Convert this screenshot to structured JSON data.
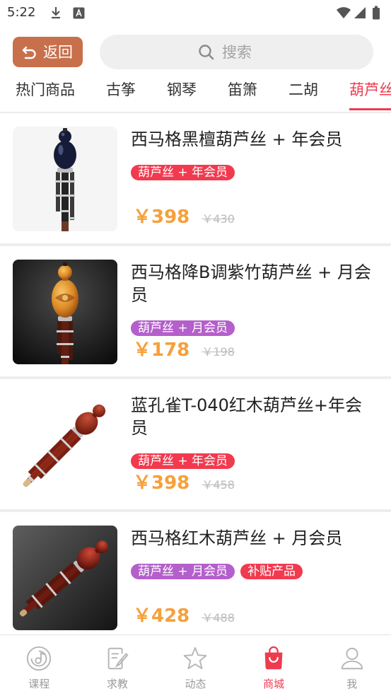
{
  "status_bar": {
    "time": "5:22",
    "left_icons": [
      "download-icon",
      "a-icon"
    ],
    "right_icons": [
      "wifi-icon",
      "signal-icon",
      "battery-icon"
    ]
  },
  "header": {
    "back_label": "返回",
    "back_icon": "return-arrow-icon",
    "search_placeholder": "搜索",
    "search_icon": "search-icon"
  },
  "tabs": [
    {
      "label": "热门商品",
      "active": false
    },
    {
      "label": "古筝",
      "active": false
    },
    {
      "label": "钢琴",
      "active": false
    },
    {
      "label": "笛箫",
      "active": false
    },
    {
      "label": "二胡",
      "active": false
    },
    {
      "label": "葫芦丝",
      "active": true
    }
  ],
  "products": [
    {
      "title": "西马格黑檀葫芦丝 + 年会员",
      "tags": [
        {
          "text": "葫芦丝 + 年会员",
          "color": "#f23a4f"
        }
      ],
      "price": "￥398",
      "original_price": "￥430"
    },
    {
      "title": "西马格降B调紫竹葫芦丝 + 月会员",
      "tags": [
        {
          "text": "葫芦丝 + 月会员",
          "color": "#b45fcb"
        }
      ],
      "price": "￥178",
      "original_price": "￥198"
    },
    {
      "title": "蓝孔雀T-040红木葫芦丝+年会员",
      "tags": [
        {
          "text": "葫芦丝 + 年会员",
          "color": "#f23a4f"
        }
      ],
      "price": "￥398",
      "original_price": "￥458"
    },
    {
      "title": "西马格红木葫芦丝 + 月会员",
      "tags": [
        {
          "text": "葫芦丝 + 月会员",
          "color": "#b45fcb"
        },
        {
          "text": "补贴产品",
          "color": "#f23a4f"
        }
      ],
      "price": "￥428",
      "original_price": "￥488"
    }
  ],
  "bottom_nav": [
    {
      "label": "课程",
      "icon": "course-disc-icon",
      "active": false
    },
    {
      "label": "求教",
      "icon": "edit-document-icon",
      "active": false
    },
    {
      "label": "动态",
      "icon": "star-icon",
      "active": false
    },
    {
      "label": "商城",
      "icon": "shopping-bag-icon",
      "active": true
    },
    {
      "label": "我",
      "icon": "person-icon",
      "active": false
    }
  ],
  "colors": {
    "accent": "#ee3b4f",
    "back_button": "#c8704c",
    "price": "#f6a03a",
    "tag_red": "#f23a4f",
    "tag_purple": "#b45fcb",
    "search_bg": "#efefef"
  }
}
